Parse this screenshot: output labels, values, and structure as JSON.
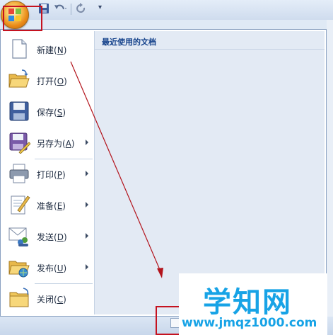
{
  "menu": {
    "commands": [
      {
        "name": "new",
        "text": "新建",
        "key": "N",
        "submenu": false
      },
      {
        "name": "open",
        "text": "打开",
        "key": "O",
        "submenu": false
      },
      {
        "name": "save",
        "text": "保存",
        "key": "S",
        "submenu": false
      },
      {
        "name": "save-as",
        "text": "另存为",
        "key": "A",
        "submenu": true
      },
      {
        "name": "print",
        "text": "打印",
        "key": "P",
        "submenu": true
      },
      {
        "name": "prepare",
        "text": "准备",
        "key": "E",
        "submenu": true
      },
      {
        "name": "send",
        "text": "发送",
        "key": "D",
        "submenu": true
      },
      {
        "name": "publish",
        "text": "发布",
        "key": "U",
        "submenu": true
      },
      {
        "name": "close",
        "text": "关闭",
        "key": "C",
        "submenu": false
      }
    ],
    "recent_title": "最近使用的文档"
  },
  "watermark": {
    "main": "学知网",
    "url": "www.jmqz1000.com"
  },
  "colors": {
    "annotation_red": "#c5121f",
    "watermark_blue": "#17a3e6",
    "menu_border": "#8aa1c1"
  }
}
